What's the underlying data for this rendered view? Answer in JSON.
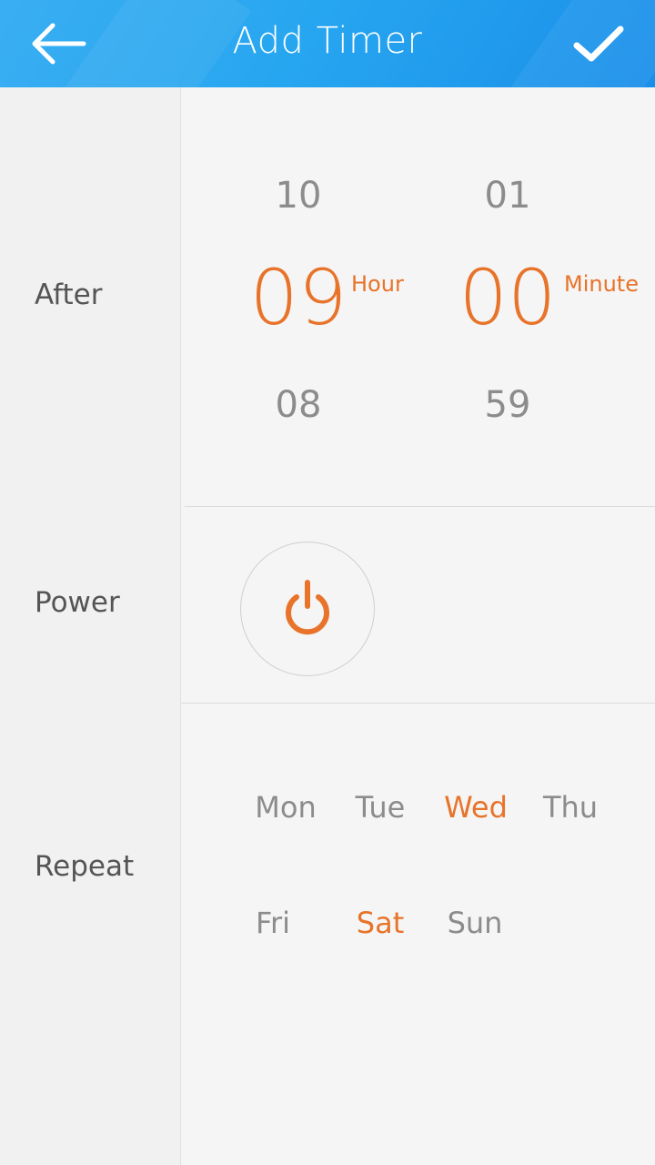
{
  "header": {
    "title": "Add Timer",
    "accent_color": "#1e9cee",
    "back_icon": "arrow-left-icon",
    "confirm_icon": "checkmark-icon"
  },
  "sidebar": {
    "after_label": "After",
    "power_label": "Power",
    "repeat_label": "Repeat"
  },
  "timer": {
    "hour_prev": "10",
    "hour_value": "09",
    "hour_next": "08",
    "hour_unit": "Hour",
    "minute_prev": "01",
    "minute_value": "00",
    "minute_next": "59",
    "minute_unit": "Minute",
    "selected_color": "#e8732a"
  },
  "power": {
    "icon": "power-icon",
    "state_color": "#e8732a"
  },
  "repeat": {
    "days": [
      {
        "label": "Mon",
        "selected": false
      },
      {
        "label": "Tue",
        "selected": false
      },
      {
        "label": "Wed",
        "selected": true
      },
      {
        "label": "Thu",
        "selected": false
      },
      {
        "label": "Fri",
        "selected": false
      },
      {
        "label": "Sat",
        "selected": true
      },
      {
        "label": "Sun",
        "selected": false
      }
    ]
  }
}
